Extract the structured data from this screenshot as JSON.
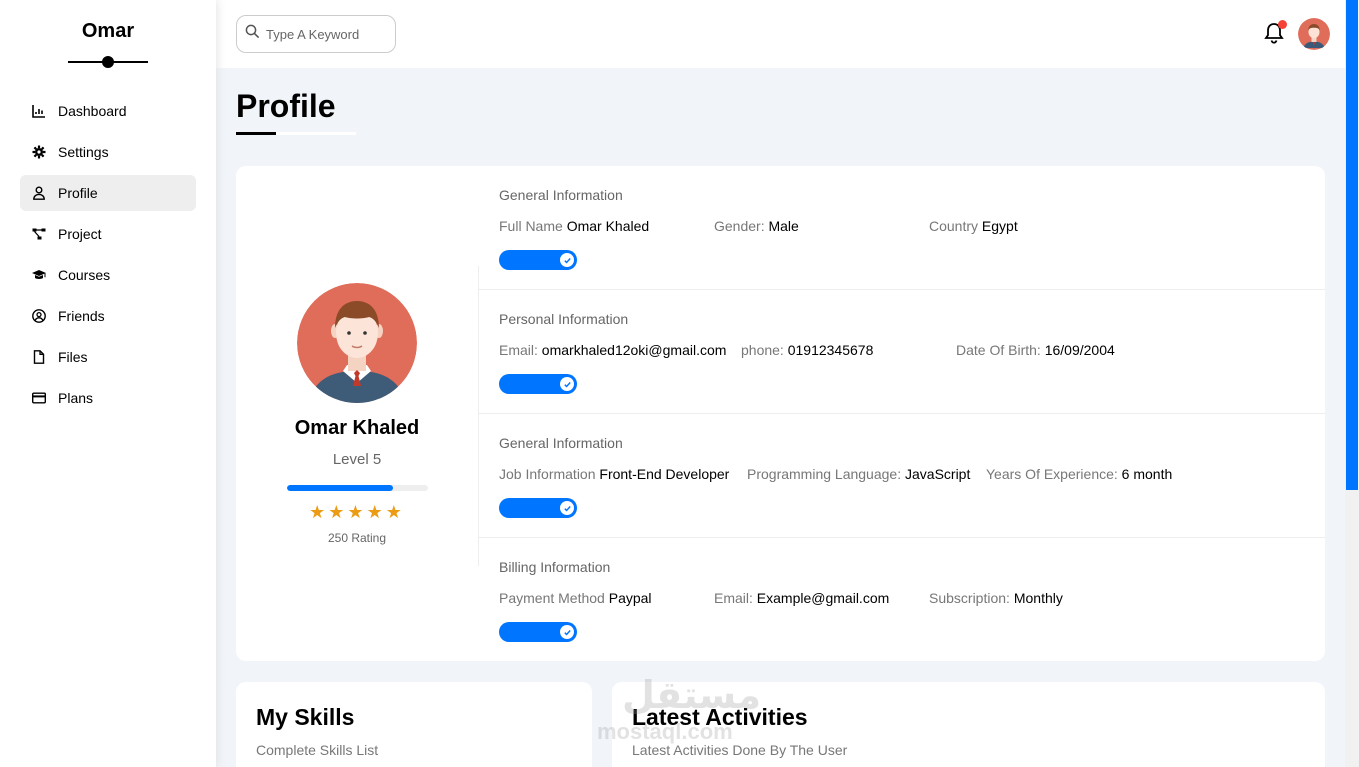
{
  "sidebar": {
    "brand": "Omar",
    "items": [
      {
        "label": "Dashboard",
        "icon": "chart-icon"
      },
      {
        "label": "Settings",
        "icon": "gear-icon"
      },
      {
        "label": "Profile",
        "icon": "user-icon"
      },
      {
        "label": "Project",
        "icon": "diagram-icon"
      },
      {
        "label": "Courses",
        "icon": "graduation-cap-icon"
      },
      {
        "label": "Friends",
        "icon": "user-circle-icon"
      },
      {
        "label": "Files",
        "icon": "file-icon"
      },
      {
        "label": "Plans",
        "icon": "credit-card-icon"
      }
    ],
    "active": "Profile"
  },
  "header": {
    "search_placeholder": "Type A Keyword",
    "notification_badge_color": "#f44336"
  },
  "page": {
    "title": "Profile"
  },
  "profile": {
    "name": "Omar Khaled",
    "level": "Level 5",
    "level_progress_percent": 75,
    "stars": 5,
    "rating": "250 Rating"
  },
  "sections": [
    {
      "title": "General Information",
      "fields": [
        {
          "label": "Full Name",
          "value": "Omar Khaled"
        },
        {
          "label": "Gender:",
          "value": "Male"
        },
        {
          "label": "Country",
          "value": "Egypt"
        }
      ],
      "toggle_on": true
    },
    {
      "title": "Personal Information",
      "fields": [
        {
          "label": "Email:",
          "value": "omarkhaled12oki@gmail.com"
        },
        {
          "label": "phone:",
          "value": "01912345678"
        },
        {
          "label": "Date Of Birth:",
          "value": "16/09/2004"
        }
      ],
      "toggle_on": true
    },
    {
      "title": "General Information",
      "fields": [
        {
          "label": "Job Information",
          "value": "Front-End Developer"
        },
        {
          "label": "Programming Language:",
          "value": "JavaScript"
        },
        {
          "label": "Years Of Experience:",
          "value": "6 month"
        }
      ],
      "toggle_on": true
    },
    {
      "title": "Billing Information",
      "fields": [
        {
          "label": "Payment Method",
          "value": "Paypal"
        },
        {
          "label": "Email:",
          "value": "Example@gmail.com"
        },
        {
          "label": "Subscription:",
          "value": "Monthly"
        }
      ],
      "toggle_on": true
    }
  ],
  "skills": {
    "title": "My Skills",
    "subtitle": "Complete Skills List"
  },
  "activities": {
    "title": "Latest Activities",
    "subtitle": "Latest Activities Done By The User"
  },
  "watermark": {
    "arabic": "مستقل",
    "latin": "mostaql.com"
  },
  "colors": {
    "accent": "#0075ff",
    "star": "#ec9b14",
    "background": "#f1f5f9"
  }
}
